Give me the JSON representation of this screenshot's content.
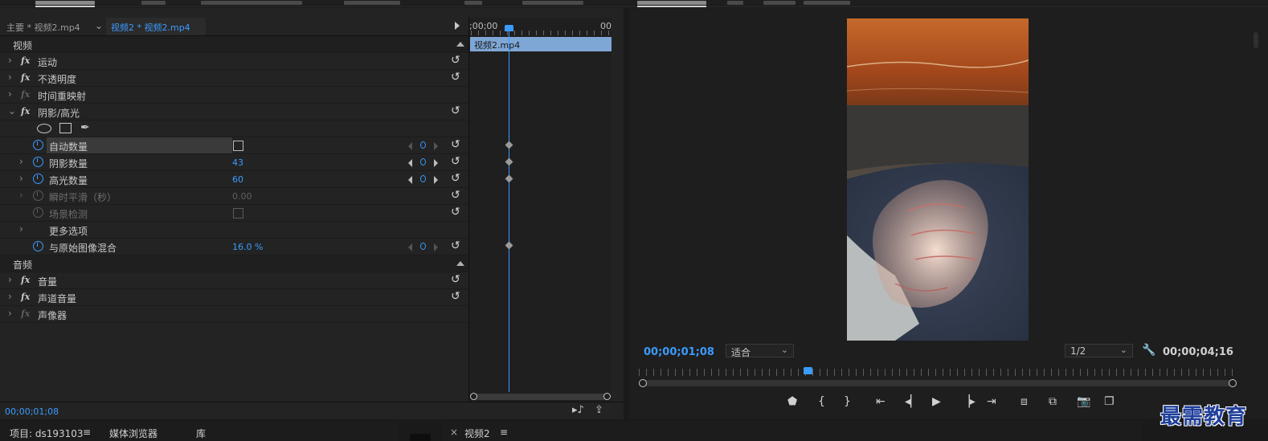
{
  "effect_controls": {
    "header": {
      "master_clip": "主要 * 视频2.mp4",
      "sequence_clip": "视频2 * 视频2.mp4"
    },
    "rows": {
      "video_section": "视频",
      "motion": "运动",
      "opacity": "不透明度",
      "time_remap": "时间重映射",
      "shadow_highlight": "阴影/高光",
      "auto_amounts": "自动数量",
      "shadow_amount": "阴影数量",
      "shadow_amount_value": "43",
      "highlight_amount": "高光数量",
      "highlight_amount_value": "60",
      "temporal_smoothing": "瞬时平滑（秒）",
      "temporal_smoothing_value": "0.00",
      "scene_detect": "场景检测",
      "more_options": "更多选项",
      "blend_with_original": "与原始图像混合",
      "blend_with_original_value": "16.0 %",
      "audio_section": "音频",
      "volume": "音量",
      "channel_volume": "声道音量",
      "panner": "声像器"
    },
    "timeline": {
      "ruler_start": ";00;00",
      "ruler_end": "00",
      "clip_name": "视频2.mp4"
    },
    "current_time": "00;00;01;08"
  },
  "program_monitor": {
    "current_time": "00;00;01;08",
    "fit_option": "适合",
    "resolution_option": "1/2",
    "duration": "00;00;04;16"
  },
  "bottom_panels": {
    "project_tab": "项目: ds193103",
    "media_browser_tab": "媒体浏览器",
    "library_tab": "库",
    "timeline_tab": "视频2"
  },
  "watermark": "最需教育",
  "colors": {
    "accent_blue": "#3b9bff",
    "panel_bg": "#232323",
    "clip_blue": "#7fa7d6"
  }
}
